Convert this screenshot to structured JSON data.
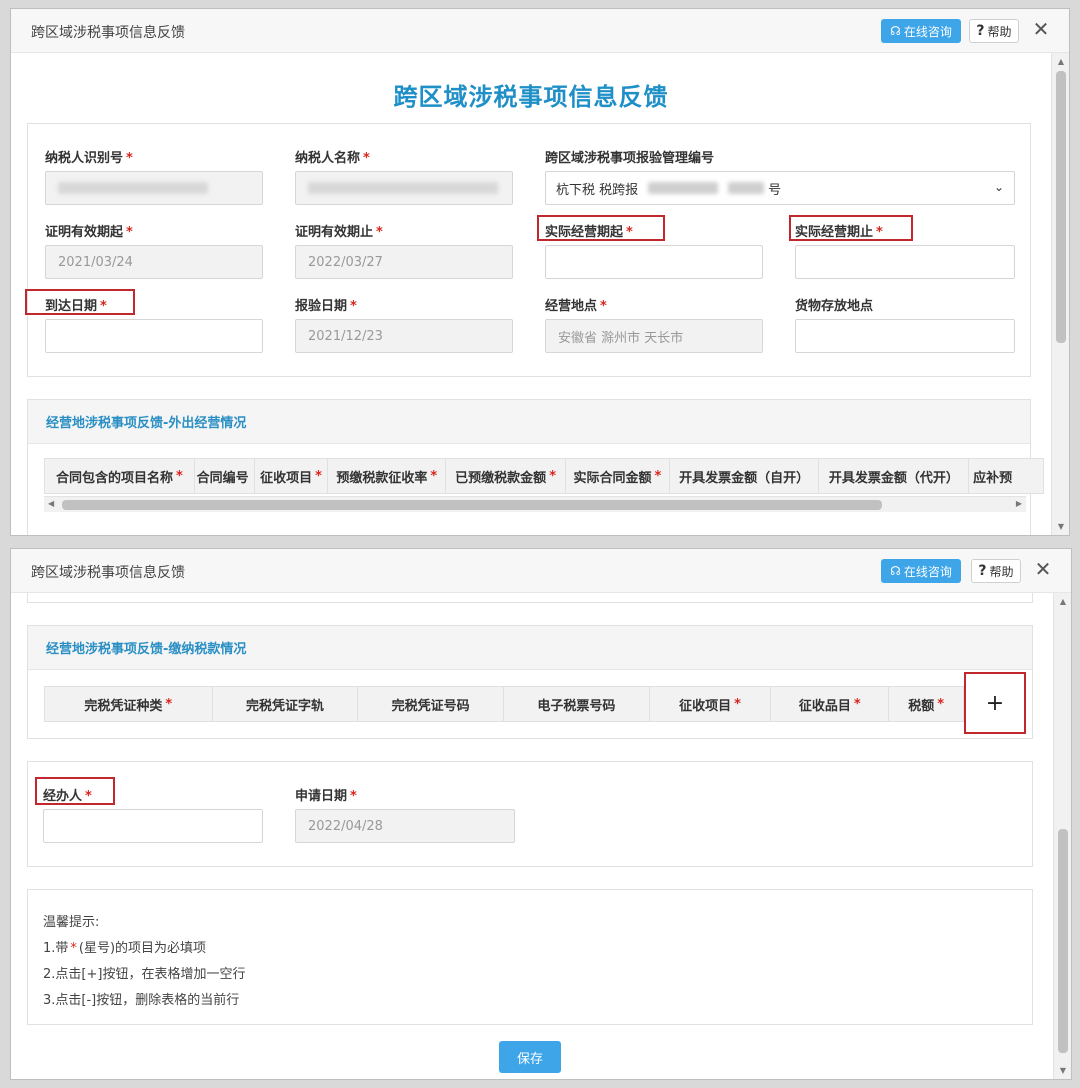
{
  "window1": {
    "title": "跨区域涉税事项信息反馈",
    "online_btn": "在线咨询",
    "help_btn": "帮助",
    "close": "✕",
    "main_title": "跨区域涉税事项信息反馈",
    "fields": {
      "taxpayer_id": {
        "label": "纳税人识别号",
        "star": "*"
      },
      "taxpayer_name": {
        "label": "纳税人名称",
        "star": "*"
      },
      "mgmt_no": {
        "label": "跨区域涉税事项报验管理编号",
        "value": "杭下税 税跨报",
        "suffix": "号"
      },
      "cert_start": {
        "label": "证明有效期起",
        "star": "*",
        "value": "2021/03/24"
      },
      "cert_end": {
        "label": "证明有效期止",
        "star": "*",
        "value": "2022/03/27"
      },
      "actual_start": {
        "label": "实际经营期起",
        "star": "*",
        "value": ""
      },
      "actual_end": {
        "label": "实际经营期止",
        "star": "*",
        "value": ""
      },
      "arrival_date": {
        "label": "到达日期",
        "star": "*",
        "value": ""
      },
      "report_date": {
        "label": "报验日期",
        "star": "*",
        "value": "2021/12/23"
      },
      "location": {
        "label": "经营地点",
        "star": "*",
        "value": "安徽省 滁州市 天长市"
      },
      "storage": {
        "label": "货物存放地点",
        "value": ""
      }
    },
    "section1_title": "经营地涉税事项反馈-外出经营情况",
    "table1_headers": [
      {
        "text": "合同包含的项目名称",
        "star": "*"
      },
      {
        "text": "合同编号",
        "star": ""
      },
      {
        "text": "征收项目",
        "star": "*"
      },
      {
        "text": "预缴税款征收率",
        "star": "*"
      },
      {
        "text": "已预缴税款金额",
        "star": "*"
      },
      {
        "text": "实际合同金额",
        "star": "*"
      },
      {
        "text": "开具发票金额（自开）",
        "star": ""
      },
      {
        "text": "开具发票金额（代开）",
        "star": ""
      },
      {
        "text": "应补预",
        "star": ""
      }
    ]
  },
  "window2": {
    "title": "跨区域涉税事项信息反馈",
    "online_btn": "在线咨询",
    "help_btn": "帮助",
    "close": "✕",
    "section2_title": "经营地涉税事项反馈-缴纳税款情况",
    "table2_headers": [
      {
        "text": "完税凭证种类",
        "star": "*"
      },
      {
        "text": "完税凭证字轨",
        "star": ""
      },
      {
        "text": "完税凭证号码",
        "star": ""
      },
      {
        "text": "电子税票号码",
        "star": ""
      },
      {
        "text": "征收项目",
        "star": "*"
      },
      {
        "text": "征收品目",
        "star": "*"
      },
      {
        "text": "税额",
        "star": "*"
      }
    ],
    "add_row": "+",
    "handler": {
      "label": "经办人",
      "star": "*",
      "value": ""
    },
    "apply_date": {
      "label": "申请日期",
      "star": "*",
      "value": "2022/04/28"
    },
    "tips_title": "温馨提示:",
    "tips": [
      {
        "pre": "1.带",
        "star": "*",
        "post": "(星号)的项目为必填项"
      },
      {
        "pre": "2.点击[+]按钮，在表格增加一空行",
        "star": "",
        "post": ""
      },
      {
        "pre": "3.点击[-]按钮，删除表格的当前行",
        "star": "",
        "post": ""
      }
    ],
    "save": "保存"
  },
  "colors": {
    "accent": "#1e8fc7",
    "button": "#3da5e8",
    "required": "#d9251d",
    "highlight_box": "#c1272d"
  }
}
